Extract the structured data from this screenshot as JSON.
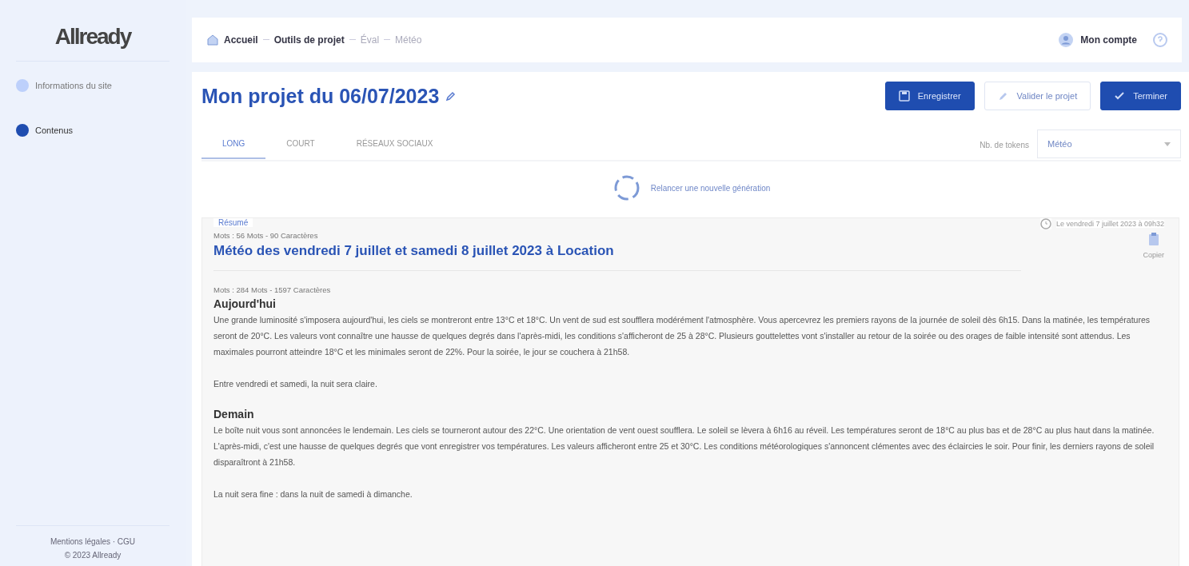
{
  "logo": "Allready",
  "sidebar": {
    "steps": [
      {
        "label": "Informations du site",
        "selected": false
      },
      {
        "label": "Contenus",
        "selected": true
      }
    ],
    "footer_links": "Mentions légales · CGU",
    "copyright": "© 2023 Allready"
  },
  "breadcrumb": [
    {
      "label": "Accueil",
      "current": false
    },
    {
      "label": "Outils de projet",
      "current": false
    },
    {
      "label": "Éval",
      "current": true
    },
    {
      "label": "Météo",
      "current": true
    }
  ],
  "account": {
    "label": "Mon compte"
  },
  "project": {
    "title": "Mon projet du 06/07/2023",
    "buttons": [
      {
        "label": "Enregistrer",
        "kind": "save"
      },
      {
        "label": "Valider le projet",
        "kind": "validate"
      },
      {
        "label": "Terminer",
        "kind": "finish"
      }
    ]
  },
  "tabs": [
    {
      "label": "LONG",
      "selected": true
    },
    {
      "label": "COURT",
      "selected": false
    },
    {
      "label": "RÉSEAUX SOCIAUX",
      "selected": false
    }
  ],
  "tone": {
    "label": "Nb. de tokens",
    "value": "Météo"
  },
  "regenerate": "Relancer une nouvelle génération",
  "result": {
    "chip": "Résumé",
    "meta": "Mots : 56 Mots - 90 Caractères",
    "title": "Météo des vendredi 7 juillet et samedi 8 juillet 2023 à Location",
    "timestamp": "Le vendredi 7 juillet 2023 à 09h32",
    "copy": "Copier",
    "body_meta": "Mots : 284 Mots - 1597 Caractères",
    "sections": [
      {
        "heading": "Aujourd'hui",
        "paragraphs": [
          "Une grande luminosité s'imposera aujourd'hui, les ciels se montreront entre 13°C et 18°C. Un vent de sud est soufflera modérément l'atmosphère. Vous apercevrez les premiers rayons de la journée de soleil dès 6h15. Dans la matinée, les températures seront de 20°C. Les valeurs vont connaître une hausse de quelques degrés dans l'après-midi, les conditions s'afficheront de 25 à 28°C. Plusieurs gouttelettes vont s'installer au retour de la soirée ou des orages de faible intensité sont attendus. Les maximales pourront atteindre 18°C et les minimales seront de 22%. Pour la soirée, le jour se couchera à 21h58.",
          "Entre vendredi et samedi, la nuit sera claire."
        ]
      },
      {
        "heading": "Demain",
        "paragraphs": [
          "Le boîte nuit vous sont annoncées le lendemain. Les ciels se tourneront autour des 22°C. Une orientation de vent ouest soufflera. Le soleil se lèvera à 6h16 au réveil. Les températures seront de 18°C au plus bas et de 28°C au plus haut dans la matinée. L'après-midi, c'est une hausse de quelques degrés que vont enregistrer vos températures. Les valeurs afficheront entre 25 et 30°C. Les conditions météorologiques s'annoncent clémentes avec des éclaircies le soir. Pour finir, les derniers rayons de soleil disparaîtront à 21h58.",
          "La nuit sera fine : dans la nuit de samedi à dimanche."
        ]
      }
    ]
  }
}
